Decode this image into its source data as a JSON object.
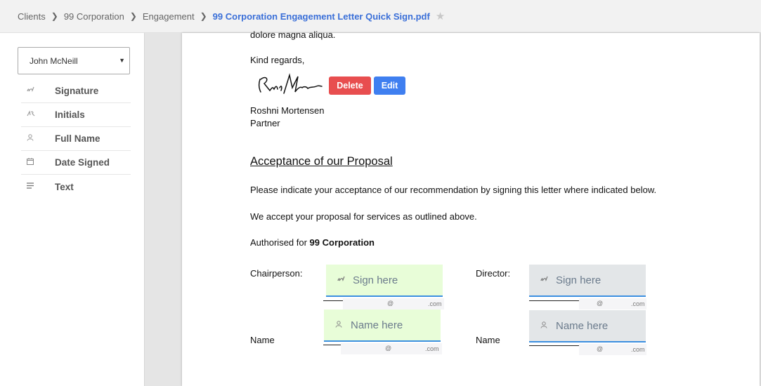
{
  "breadcrumb": {
    "items": [
      "Clients",
      "99 Corporation",
      "Engagement"
    ],
    "current": "99 Corporation Engagement Letter Quick Sign.pdf"
  },
  "sidebar": {
    "signer": "John McNeill",
    "fields": [
      {
        "label": "Signature",
        "icon": "signature-icon"
      },
      {
        "label": "Initials",
        "icon": "initials-icon"
      },
      {
        "label": "Full Name",
        "icon": "person-icon"
      },
      {
        "label": "Date Signed",
        "icon": "calendar-icon"
      },
      {
        "label": "Text",
        "icon": "text-lines-icon"
      }
    ]
  },
  "document": {
    "cut_text": "dolore magna aliqua.",
    "kind_regards": "Kind regards,",
    "delete_label": "Delete",
    "edit_label": "Edit",
    "signer_name": "Roshni Mortensen",
    "signer_title": "Partner",
    "section_heading": "Acceptance of our Proposal",
    "para1": "Please indicate your acceptance of our recommendation by signing this letter where indicated below.",
    "para2": "We accept your proposal for services as outlined above.",
    "authorised_prefix": "Authorised for ",
    "authorised_company": "99 Corporation",
    "chairperson_label": "Chairperson:",
    "director_label": "Director:",
    "name_label": "Name",
    "sign_here": "Sign here",
    "name_here": "Name here",
    "email_at": "@",
    "email_com": ".com"
  }
}
